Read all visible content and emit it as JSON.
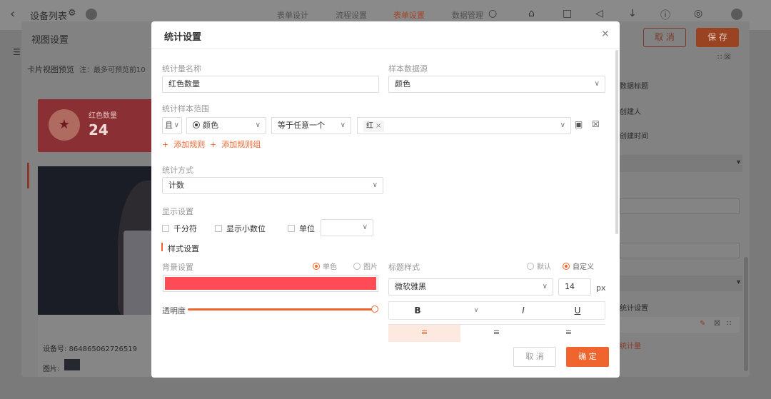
{
  "app": {
    "title": "设备列表",
    "tabs": [
      "表单设计",
      "流程设置",
      "表单设置",
      "数据管理"
    ],
    "active_tab": "表单设置"
  },
  "view_settings": {
    "title": "视图设置",
    "cancel_label": "取 消",
    "save_label": "保 存",
    "preview_title": "卡片视图预览",
    "preview_note": "注：最多可预览前10",
    "stat_card": {
      "label": "红色数量",
      "value": "24",
      "bg_color": "#ff4b55"
    },
    "device_label": "设备号:",
    "device_value": "864865062726519",
    "image_label": "图片:",
    "right_items": [
      "数据标题",
      "创建人",
      "创建时间",
      "统计设置",
      "统计量"
    ]
  },
  "modal": {
    "title": "统计设置",
    "name_label": "统计量名称",
    "name_value": "红色数量",
    "source_label": "样本数据源",
    "source_value": "颜色",
    "range_label": "统计样本范围",
    "rule": {
      "conj": "且",
      "field": "颜色",
      "operator": "等于任意一个",
      "values": [
        "红"
      ]
    },
    "add_rule": "添加规则",
    "add_rule_group": "添加规则组",
    "method_label": "统计方式",
    "method_value": "计数",
    "display_label": "显示设置",
    "display_opts": {
      "thousands": "千分符",
      "decimals": "显示小数位",
      "unit": "单位"
    },
    "style_label": "样式设置",
    "bg_label": "背景设置",
    "bg_opts": {
      "solid": "单色",
      "image": "图片",
      "selected": "单色"
    },
    "bg_color": "#ff4b55",
    "opacity_label": "透明度",
    "opacity": 1.0,
    "title_style_label": "标题样式",
    "title_style_opts": {
      "default": "默认",
      "custom": "自定义",
      "selected": "自定义"
    },
    "font_family": "微软雅黑",
    "font_size": "14",
    "font_unit": "px",
    "format_buttons": {
      "bold": "B",
      "italic": "I",
      "underline": "U"
    },
    "align_selected": "left",
    "cancel_label": "取 消",
    "ok_label": "确 定",
    "accent_color": "#f0642e"
  }
}
